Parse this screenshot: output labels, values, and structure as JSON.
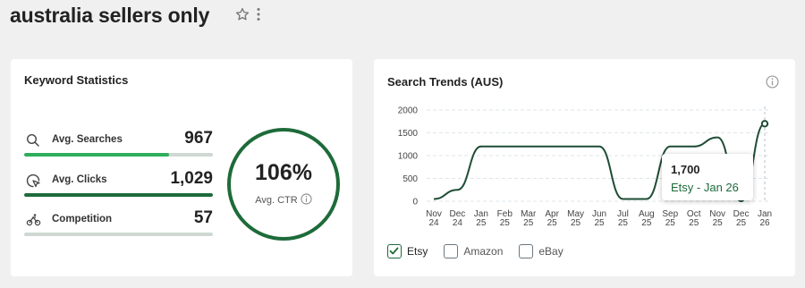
{
  "page": {
    "title": "australia sellers only"
  },
  "keyword_stats": {
    "title": "Keyword Statistics",
    "stats": [
      {
        "label": "Avg. Searches",
        "value": "967",
        "icon": "search-icon",
        "bar_fraction": 0.77,
        "bar_color": "#2fae5c"
      },
      {
        "label": "Avg. Clicks",
        "value": "1,029",
        "icon": "click-icon",
        "bar_fraction": 1.0,
        "bar_color": "#1e6b3a"
      },
      {
        "label": "Competition",
        "value": "57",
        "icon": "competition-icon",
        "bar_fraction": 0,
        "bar_color": "#cfd8d3"
      }
    ],
    "ctr": {
      "value": "106%",
      "label": "Avg. CTR"
    }
  },
  "search_trends": {
    "title": "Search Trends (AUS)",
    "tooltip": {
      "value": "1,700",
      "series": "Etsy - Jan 26"
    },
    "legend": [
      {
        "label": "Etsy",
        "checked": true
      },
      {
        "label": "Amazon",
        "checked": false
      },
      {
        "label": "eBay",
        "checked": false
      }
    ]
  },
  "chart_data": {
    "type": "line",
    "title": "Search Trends (AUS)",
    "categories": [
      [
        "Nov",
        "24"
      ],
      [
        "Dec",
        "24"
      ],
      [
        "Jan",
        "25"
      ],
      [
        "Feb",
        "25"
      ],
      [
        "Mar",
        "25"
      ],
      [
        "Apr",
        "25"
      ],
      [
        "May",
        "25"
      ],
      [
        "Jun",
        "25"
      ],
      [
        "Jul",
        "25"
      ],
      [
        "Aug",
        "25"
      ],
      [
        "Sep",
        "25"
      ],
      [
        "Oct",
        "25"
      ],
      [
        "Nov",
        "25"
      ],
      [
        "Dec",
        "25"
      ],
      [
        "Jan",
        "26"
      ]
    ],
    "series": [
      {
        "name": "Etsy",
        "color": "#1e4d35",
        "values": [
          50,
          250,
          1200,
          1200,
          1200,
          1200,
          1200,
          1200,
          50,
          50,
          1200,
          1200,
          1400,
          0,
          1700
        ]
      }
    ],
    "ylim": [
      0,
      2000
    ],
    "yticks": [
      "0",
      "500",
      "1000",
      "1500",
      "2000"
    ],
    "grid": true,
    "highlight_index": 14
  }
}
